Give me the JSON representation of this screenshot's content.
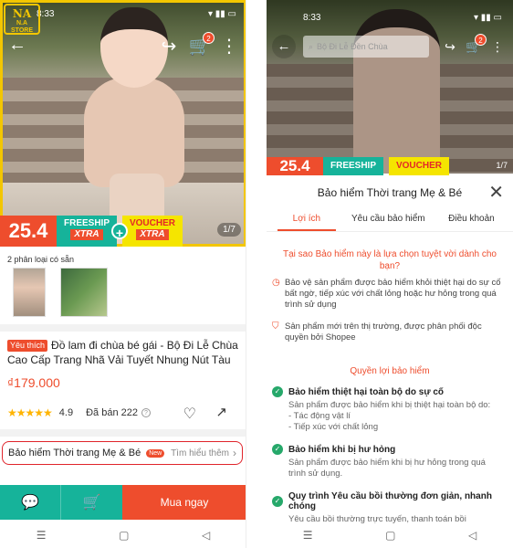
{
  "left": {
    "status": {
      "time": "8:33"
    },
    "store_logo": {
      "mark": "NA",
      "name": "N.A STORE"
    },
    "cart_count": "2",
    "promo": {
      "number": "25.4",
      "freeship": "FREESHIP",
      "xtra1": "XTRA",
      "plus": "+",
      "voucher": "VOUCHER",
      "xtra2": "XTRA",
      "image_counter": "1/7"
    },
    "variants_label": "2 phân loại có sẵn",
    "favorite_tag": "Yêu thích",
    "title": "Đồ lam đi chùa bé gái - Bộ Đi Lễ Chùa Cao Cấp Trang Nhã Vải Tuyết Nhung Nút Tàu",
    "price": "₫179.000",
    "rating": {
      "stars": 4.9,
      "value": "4.9",
      "sold": "Đã bán 222"
    },
    "insurance": {
      "label": "Bảo hiểm Thời trang Mẹ & Bé",
      "badge": "New",
      "link": "Tìm hiểu thêm"
    },
    "buy_label": "Mua ngay"
  },
  "right": {
    "status": {
      "time": "8:33"
    },
    "search_placeholder": "Bộ Đi Lễ Đền Chùa",
    "cart_count": "2",
    "promo": {
      "number": "25.4",
      "freeship": "FREESHIP",
      "voucher": "VOUCHER",
      "image_counter": "1/7"
    },
    "sheet": {
      "title": "Bảo hiểm Thời trang Mẹ & Bé",
      "tabs": [
        "Lợi ích",
        "Yêu cầu bảo hiểm",
        "Điều khoản"
      ],
      "why_title": "Tại sao Bảo hiểm này là lựa chọn tuyệt vời dành cho bạn?",
      "bullets": [
        "Bảo vệ sản phẩm được bảo hiểm khỏi thiệt hại do sự cố bất ngờ, tiếp xúc với chất lỏng hoặc hư hỏng trong quá trình sử dụng",
        "Sản phẩm mới trên thị trường, được phân phối độc quyền bởi Shopee"
      ],
      "benefits_title": "Quyền lợi bảo hiểm",
      "benefits": [
        {
          "heading": "Bảo hiểm thiệt hại toàn bộ do sự cố",
          "body": "Sản phẩm được bảo hiểm khi bị thiệt hại toàn bộ do:",
          "items": [
            "- Tác động vật lí",
            "- Tiếp xúc với chất lỏng"
          ]
        },
        {
          "heading": "Bảo hiểm khi bị hư hỏng",
          "body": "Sản phẩm được bảo hiểm khi bị hư hỏng trong quá trình sử dụng.",
          "items": []
        },
        {
          "heading": "Quy trình Yêu cầu bồi thường đơn giản, nhanh chóng",
          "body": "Yêu cầu bồi thường trực tuyến, thanh toán bồi",
          "items": []
        }
      ]
    }
  }
}
